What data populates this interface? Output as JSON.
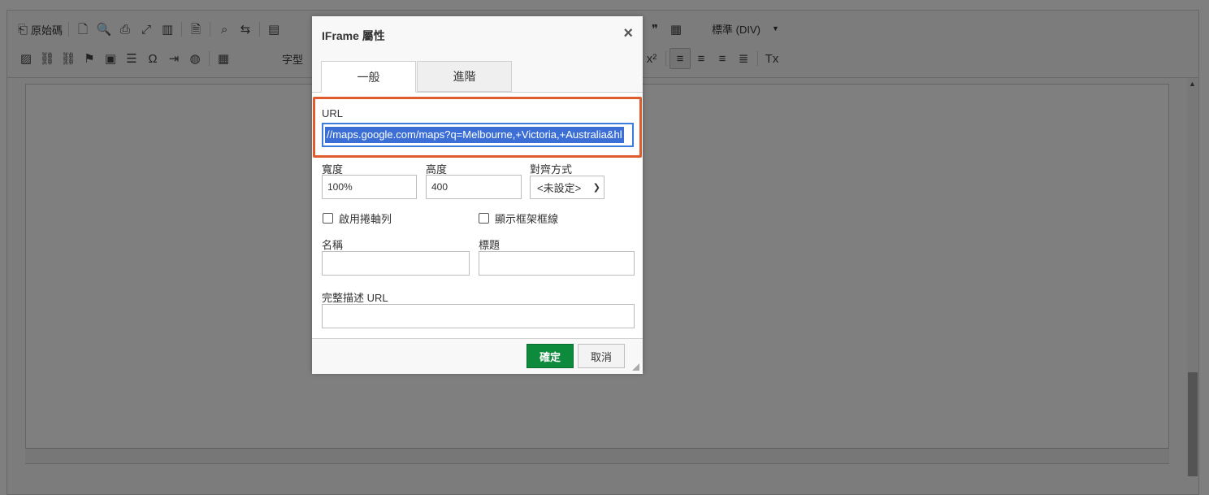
{
  "toolbar": {
    "row1": [
      {
        "name": "source-button",
        "icon": "⎗",
        "label": "原始碼"
      },
      {
        "sep": true
      },
      {
        "name": "new-page-button",
        "icon": "🗋"
      },
      {
        "name": "preview-button",
        "icon": "🔍"
      },
      {
        "name": "print-button",
        "icon": "⎙"
      },
      {
        "name": "maximize-button",
        "icon": "⤢"
      },
      {
        "name": "show-blocks-button",
        "icon": "▥"
      },
      {
        "sep": true
      },
      {
        "name": "templates-button",
        "icon": "🗎"
      },
      {
        "sep": true
      },
      {
        "name": "find-button",
        "icon": "⌕"
      },
      {
        "name": "replace-button",
        "icon": "⇆"
      },
      {
        "sep": true
      },
      {
        "name": "select-all-button",
        "icon": "▤"
      }
    ],
    "row1_right": [
      {
        "name": "blockquote-button",
        "icon": "❞"
      },
      {
        "name": "div-button",
        "icon": "▦"
      }
    ],
    "format_combo": "標準 (DIV)",
    "row2": [
      {
        "name": "image-button",
        "icon": "▨"
      },
      {
        "name": "link-button",
        "icon": "⛓"
      },
      {
        "name": "unlink-button",
        "icon": "⛓"
      },
      {
        "name": "anchor-button",
        "icon": "⚑"
      },
      {
        "name": "youtube-button",
        "icon": "▣"
      },
      {
        "name": "hr-button",
        "icon": "☰"
      },
      {
        "name": "special-char-button",
        "icon": "Ω"
      },
      {
        "name": "iframe-button",
        "icon": "⇥"
      },
      {
        "name": "globe-button",
        "icon": "◍"
      },
      {
        "sep": true
      },
      {
        "name": "table-button",
        "icon": "▦"
      }
    ],
    "font_label": "字型",
    "row2_right": [
      {
        "name": "superscript-button",
        "icon": "x²"
      },
      {
        "sep": true
      },
      {
        "name": "align-left-button",
        "icon": "≡",
        "active": true
      },
      {
        "name": "align-center-button",
        "icon": "≡"
      },
      {
        "name": "align-right-button",
        "icon": "≡"
      },
      {
        "name": "justify-button",
        "icon": "≣"
      },
      {
        "sep": true
      },
      {
        "name": "remove-format-button",
        "icon": "Tx"
      }
    ]
  },
  "dialog": {
    "title": "IFrame 屬性",
    "close_symbol": "×",
    "tabs": [
      "一般",
      "進階"
    ],
    "url_label": "URL",
    "url_value": "//maps.google.com/maps?q=Melbourne,+Victoria,+Australia&hl",
    "width_label": "寬度",
    "width_value": "100%",
    "height_label": "高度",
    "height_value": "400",
    "align_label": "對齊方式",
    "align_value": "<未設定>",
    "scroll_label": "啟用捲軸列",
    "frameborder_label": "顯示框架框線",
    "name_label": "名稱",
    "name_value": "",
    "title_label": "標題",
    "title_value": "",
    "longdesc_label": "完整描述 URL",
    "longdesc_value": "",
    "ok_label": "確定",
    "cancel_label": "取消"
  },
  "colors": {
    "ok_button": "#0e8a3d",
    "highlight_border": "#e05b2d",
    "selection": "#3b6fd6"
  }
}
